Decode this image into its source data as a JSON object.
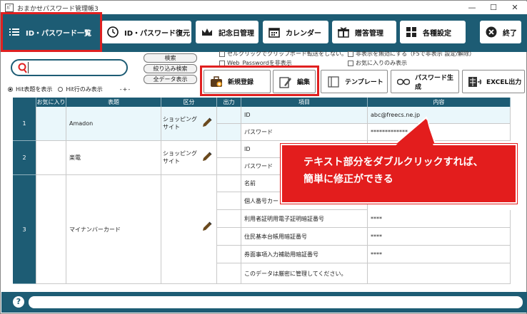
{
  "window": {
    "title": "おまかせパスワード管理帳3",
    "minimize": "—",
    "maximize": "☐",
    "close": "✕"
  },
  "nav": {
    "id_list": "ID・パスワード一覧",
    "id_restore": "ID・パスワード復元",
    "anniversary": "記念日管理",
    "calendar": "カレンダー",
    "gift": "贈答管理",
    "settings": "各種設定",
    "exit": "終了"
  },
  "search": {
    "value": "",
    "search_btn": "検索",
    "filter_btn": "絞り込み検索",
    "all_btn": "全データ表示"
  },
  "options": {
    "radio_hit_highlight": "Hit表題を表示",
    "radio_hit_only": "Hit行のみ表示",
    "check_selclick": "セルクリックでクリップボード転送をしない。",
    "check_web_password": "Web_Passwordを非表示",
    "check_hidden_enable": "非表示を無効にする（F5で非表示 設定/解除）",
    "check_favorites_only": "お気に入りのみ表示"
  },
  "actions": {
    "new": "新規登録",
    "edit": "編集",
    "template": "テンプレート",
    "pwgen": "パスワード生成",
    "excel": "EXCEL出力"
  },
  "table": {
    "headers": [
      "お気に入り",
      "表題",
      "区分",
      "出力",
      "項目",
      "内容"
    ],
    "rows": [
      {
        "num": "1",
        "title": "Amadon",
        "category": "ショッピングサイト",
        "items": [
          [
            "ID",
            "abc@freecs.ne.jp"
          ],
          [
            "パスワード",
            "*************"
          ]
        ]
      },
      {
        "num": "2",
        "title": "楽電",
        "category": "ショッピングサイト",
        "items": [
          [
            "ID",
            ""
          ],
          [
            "パスワード",
            ""
          ]
        ]
      },
      {
        "num": "3",
        "title": "マイナンバーカード",
        "category": "",
        "items": [
          [
            "名前",
            ""
          ],
          [
            "個人番号カード",
            ""
          ],
          [
            "利用者証明用電子証明暗証番号",
            "****"
          ],
          [
            "住民基本台帳用暗証番号",
            "****"
          ],
          [
            "券面事項入力補助用暗証番号",
            "****"
          ],
          [
            "このデータは厳密に管理してください。",
            ""
          ]
        ]
      }
    ]
  },
  "callout": {
    "line1": "テキスト部分をダブルクリックすれば、",
    "line2": "簡単に修正ができる"
  },
  "colors": {
    "brand": "#1d5c74",
    "highlight": "#e02020"
  }
}
